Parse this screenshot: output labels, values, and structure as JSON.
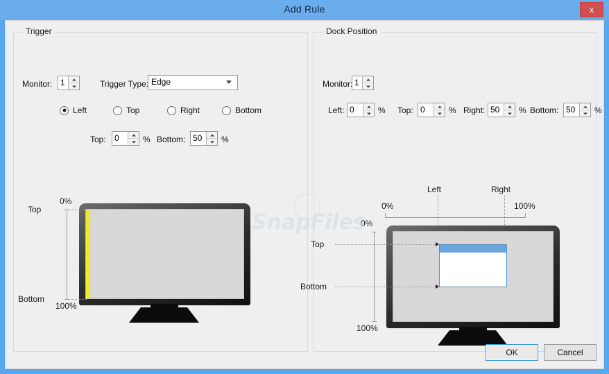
{
  "window": {
    "title": "Add Rule",
    "close_label": "x"
  },
  "watermark": {
    "text": "SnapFiles"
  },
  "trigger": {
    "group_title": "Trigger",
    "monitor_label": "Monitor:",
    "monitor_value": "1",
    "trigger_type_label": "Trigger Type:",
    "trigger_type_value": "Edge",
    "trigger_type_options": [
      "Edge"
    ],
    "edges": [
      {
        "label": "Left",
        "selected": true
      },
      {
        "label": "Top",
        "selected": false
      },
      {
        "label": "Right",
        "selected": false
      },
      {
        "label": "Bottom",
        "selected": false
      }
    ],
    "top_label": "Top:",
    "top_value": "0",
    "top_unit": "%",
    "bottom_label": "Bottom:",
    "bottom_value": "50",
    "bottom_unit": "%",
    "preview": {
      "top_caption": "Top",
      "bottom_caption": "Bottom",
      "zero_pct": "0%",
      "hundred_pct": "100%",
      "edge_color": "#f2e92b"
    }
  },
  "dock": {
    "group_title": "Dock Position",
    "monitor_label": "Monitor:",
    "monitor_value": "1",
    "left_label": "Left:",
    "left_value": "0",
    "left_unit": "%",
    "top_label": "Top:",
    "top_value": "0",
    "top_unit": "%",
    "right_label": "Right:",
    "right_value": "50",
    "right_unit": "%",
    "bottom_label": "Bottom:",
    "bottom_value": "50",
    "bottom_unit": "%",
    "preview": {
      "left_caption": "Left",
      "right_caption": "Right",
      "top_caption": "Top",
      "bottom_caption": "Bottom",
      "h_zero_pct": "0%",
      "h_hundred_pct": "100%",
      "v_zero_pct": "0%",
      "v_hundred_pct": "100%",
      "dock_titlebar_color": "#6aa7e0"
    }
  },
  "footer": {
    "ok_label": "OK",
    "cancel_label": "Cancel"
  }
}
